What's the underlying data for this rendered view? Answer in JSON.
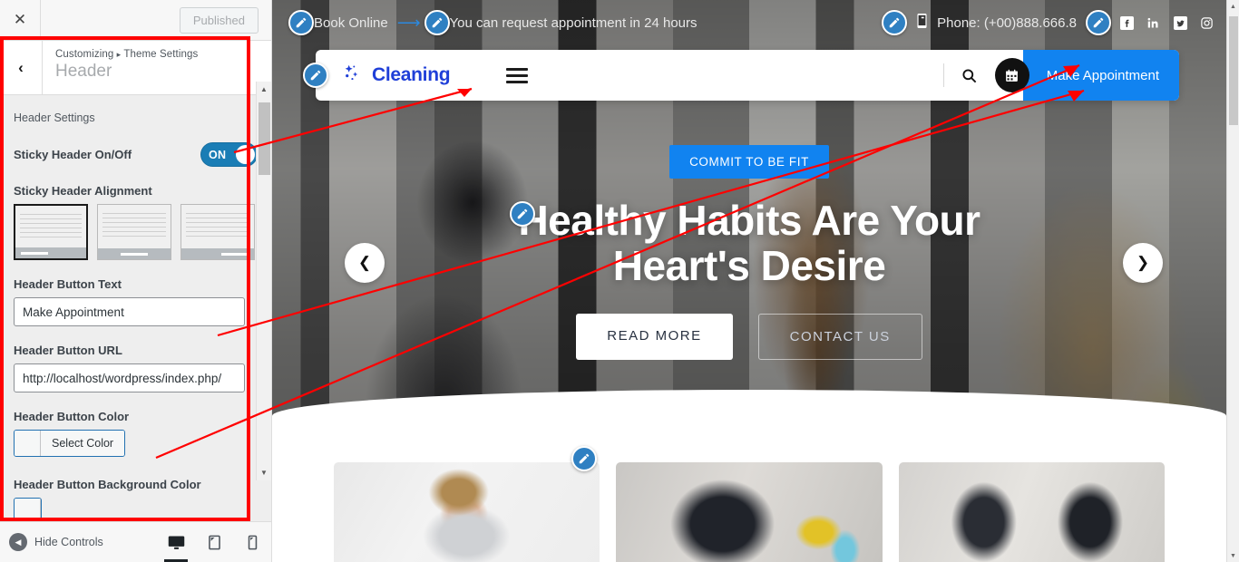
{
  "customizer": {
    "close_icon": "close-icon",
    "publish_label": "Published",
    "back_icon": "chevron-left-icon",
    "breadcrumb_prefix": "Customizing",
    "breadcrumb_sep": "▸",
    "breadcrumb_parent": "Theme Settings",
    "panel_title": "Header",
    "section_label": "Header Settings",
    "fields": {
      "sticky_toggle_label": "Sticky Header On/Off",
      "sticky_toggle_state": "ON",
      "alignment_label": "Sticky Header Alignment",
      "alignment_options": [
        "left",
        "center",
        "right"
      ],
      "alignment_selected": "left",
      "button_text_label": "Header Button Text",
      "button_text_value": "Make Appointment",
      "button_url_label": "Header Button URL",
      "button_url_value": "http://localhost/wordpress/index.php/",
      "button_color_label": "Header Button Color",
      "button_color_select": "Select Color",
      "button_bg_color_label": "Header Button Background Color"
    },
    "footer": {
      "hide_controls_label": "Hide Controls",
      "hide_controls_icon": "caret-left-circle-icon",
      "devices": [
        {
          "name": "desktop",
          "icon": "desktop-icon",
          "active": true
        },
        {
          "name": "tablet",
          "icon": "tablet-icon",
          "active": false
        },
        {
          "name": "mobile",
          "icon": "mobile-icon",
          "active": false
        }
      ]
    }
  },
  "preview": {
    "topbar": {
      "book_online": "Book Online",
      "arrow_icon": "arrow-right-icon",
      "tagline": "You can request appointment in 24 hours",
      "phone_icon": "mobile-phone-icon",
      "phone": "Phone: (+00)888.666.8",
      "social": [
        "facebook-icon",
        "linkedin-icon",
        "twitter-icon",
        "instagram-icon"
      ]
    },
    "nav": {
      "logo_icon": "sparkle-icon",
      "brand": "Cleaning",
      "menu_icon": "hamburger-menu-icon",
      "search_icon": "search-icon",
      "calendar_icon": "calendar-icon",
      "appointment_button": "Make Appointment"
    },
    "hero": {
      "badge": "COMMIT TO BE FIT",
      "title_line1": "Healthy Habits Are Your",
      "title_line2": "Heart's Desire",
      "primary_button": "READ MORE",
      "secondary_button": "CONTACT US",
      "prev_icon": "chevron-left-icon",
      "next_icon": "chevron-right-icon"
    }
  },
  "colors": {
    "accent_blue": "#1183f0",
    "brand_blue": "#1f3fd8",
    "toggle_blue": "#1a7db5",
    "annotation_red": "#ff0000",
    "pencil_blue": "#2f80c2"
  }
}
